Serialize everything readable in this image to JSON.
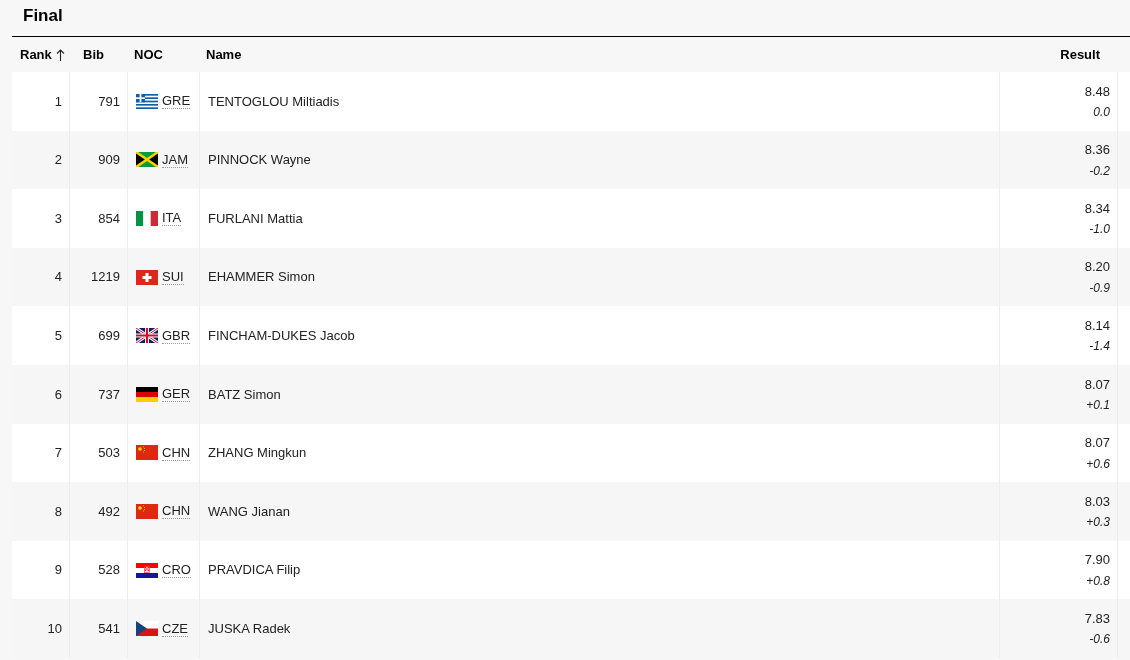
{
  "title": "Final",
  "columns": [
    {
      "label": "Rank",
      "sorted": true
    },
    {
      "label": "Bib",
      "sorted": false
    },
    {
      "label": "NOC",
      "sorted": false
    },
    {
      "label": "Name",
      "sorted": false
    },
    {
      "label": "Result",
      "sorted": false
    }
  ],
  "rows": [
    {
      "rank": "1",
      "bib": "791",
      "kind": "gre",
      "noc": "GRE",
      "name": "TENTOGLOU Miltiadis",
      "result": "8.48",
      "wind": "0.0"
    },
    {
      "rank": "2",
      "bib": "909",
      "kind": "jam",
      "noc": "JAM",
      "name": "PINNOCK Wayne",
      "result": "8.36",
      "wind": "-0.2"
    },
    {
      "rank": "3",
      "bib": "854",
      "kind": "ita",
      "noc": "ITA",
      "name": "FURLANI Mattia",
      "result": "8.34",
      "wind": "-1.0"
    },
    {
      "rank": "4",
      "bib": "1219",
      "kind": "sui",
      "noc": "SUI",
      "name": "EHAMMER Simon",
      "result": "8.20",
      "wind": "-0.9"
    },
    {
      "rank": "5",
      "bib": "699",
      "kind": "gbr",
      "noc": "GBR",
      "name": "FINCHAM-DUKES Jacob",
      "result": "8.14",
      "wind": "-1.4"
    },
    {
      "rank": "6",
      "bib": "737",
      "kind": "ger",
      "noc": "GER",
      "name": "BATZ Simon",
      "result": "8.07",
      "wind": "+0.1"
    },
    {
      "rank": "7",
      "bib": "503",
      "kind": "chn",
      "noc": "CHN",
      "name": "ZHANG Mingkun",
      "result": "8.07",
      "wind": "+0.6"
    },
    {
      "rank": "8",
      "bib": "492",
      "kind": "chn",
      "noc": "CHN",
      "name": "WANG Jianan",
      "result": "8.03",
      "wind": "+0.3"
    },
    {
      "rank": "9",
      "bib": "528",
      "kind": "cro",
      "noc": "CRO",
      "name": "PRAVDICA Filip",
      "result": "7.90",
      "wind": "+0.8"
    },
    {
      "rank": "10",
      "bib": "541",
      "kind": "cze",
      "noc": "CZE",
      "name": "JUSKA Radek",
      "result": "7.83",
      "wind": "-0.6"
    }
  ]
}
